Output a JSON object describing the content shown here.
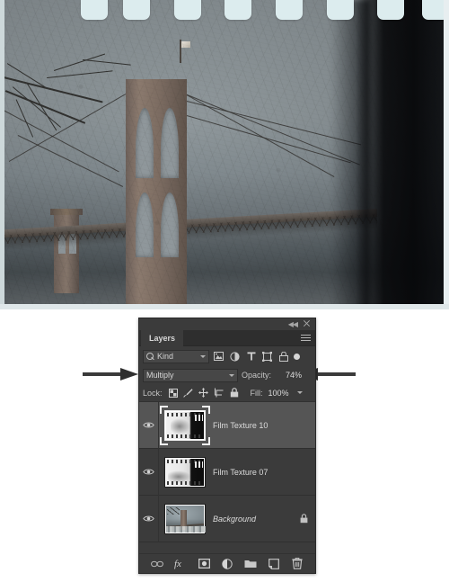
{
  "document": {
    "title": "Photoshop Layers panel — film texture blend",
    "canvas_description": "Brooklyn Bridge photograph overlaid with film-strip grunge textures"
  },
  "canvas": {
    "name": "image-canvas",
    "photo_subject": "Brooklyn Bridge",
    "overlay": "film strip sprocket holes along top edge"
  },
  "panel": {
    "title": "Layers",
    "tab_label": "Layers",
    "collapse_icon": "collapse-double-arrow-icon",
    "close_icon": "close-icon",
    "menu_icon": "panel-menu-icon",
    "filter": {
      "search_icon": "search-icon",
      "kind_label": "Kind",
      "caret_icon": "chevron-down-icon",
      "buttons": [
        {
          "name": "filter-pixel-layers",
          "icon": "image-icon",
          "glyph": "▣"
        },
        {
          "name": "filter-adjustment-layers",
          "icon": "adjustment-circle-icon",
          "glyph": "◑"
        },
        {
          "name": "filter-type-layers",
          "icon": "text-T-icon",
          "glyph": "T"
        },
        {
          "name": "filter-shape-layers",
          "icon": "shape-frame-icon",
          "glyph": "⬚"
        },
        {
          "name": "filter-smart-objects",
          "icon": "smart-object-lock-icon",
          "glyph": "🔒"
        }
      ],
      "toggle_name": "filter-enable-toggle"
    },
    "blend": {
      "mode_label": "Multiply",
      "caret_icon": "chevron-down-icon",
      "opacity_label": "Opacity:",
      "opacity_value": "74%"
    },
    "lock": {
      "label": "Lock:",
      "buttons": [
        {
          "name": "lock-transparent-pixels",
          "icon": "checkerboard-icon"
        },
        {
          "name": "lock-image-pixels",
          "icon": "brush-icon"
        },
        {
          "name": "lock-position",
          "icon": "move-arrows-icon"
        },
        {
          "name": "lock-artboard-nesting",
          "icon": "artboard-icon"
        },
        {
          "name": "lock-all",
          "icon": "padlock-icon"
        }
      ],
      "fill_label": "Fill:",
      "fill_value": "100%"
    },
    "layers": [
      {
        "name": "Film Texture 10",
        "selected": true,
        "visible": true,
        "locked": false,
        "italic": false,
        "thumbnail": "film-strip-texture"
      },
      {
        "name": "Film Texture 07",
        "selected": false,
        "visible": true,
        "locked": false,
        "italic": false,
        "thumbnail": "film-strip-texture"
      },
      {
        "name": "Background",
        "selected": false,
        "visible": true,
        "locked": true,
        "italic": true,
        "thumbnail": "brooklyn-bridge-photo"
      }
    ],
    "footer_buttons": [
      {
        "name": "link-layers-button",
        "icon": "link-chain-icon"
      },
      {
        "name": "layer-style-button",
        "icon": "fx-icon"
      },
      {
        "name": "layer-mask-button",
        "icon": "mask-rectangle-icon"
      },
      {
        "name": "new-fill-adjustment-button",
        "icon": "half-circle-icon"
      },
      {
        "name": "new-group-button",
        "icon": "folder-icon"
      },
      {
        "name": "new-layer-button",
        "icon": "new-layer-page-icon"
      },
      {
        "name": "delete-layer-button",
        "icon": "trash-icon"
      }
    ]
  },
  "annotations": [
    {
      "name": "annotation-arrow-to-blend-mode",
      "points_to": "blend-mode-dropdown",
      "direction": "right"
    },
    {
      "name": "annotation-arrow-to-opacity",
      "points_to": "opacity-field",
      "direction": "left"
    }
  ],
  "colors": {
    "panel_bg": "#3b3b3b",
    "panel_field": "#474747",
    "panel_tab_strip": "#2e2e2e",
    "selected_row": "#555555",
    "text": "#d6d6d6",
    "page_bg": "#ffffff"
  }
}
